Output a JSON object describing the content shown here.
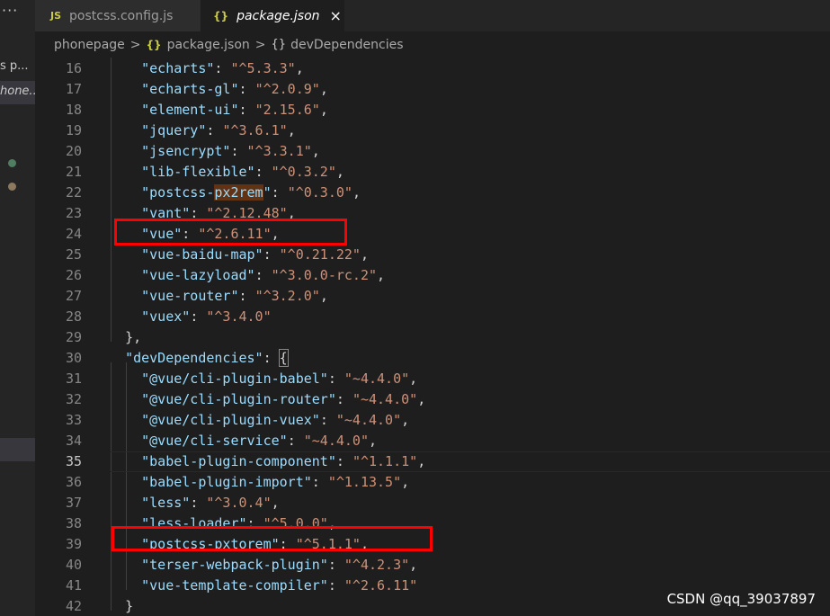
{
  "sidebar": {
    "more": "···",
    "item1": "s p...",
    "item2": "hone..."
  },
  "tabs": [
    {
      "icon": "JS",
      "label": "postcss.config.js"
    },
    {
      "icon": "{}",
      "label": "package.json",
      "close": "×"
    }
  ],
  "breadcrumb": {
    "folder": "phonepage",
    "file": "package.json",
    "node": "devDependencies",
    "sep": ">"
  },
  "editor": {
    "lines": [
      {
        "n": "16",
        "key": "\"echarts\"",
        "val": "\"^5.3.3\"",
        "end": ","
      },
      {
        "n": "17",
        "key": "\"echarts-gl\"",
        "val": "\"^2.0.9\"",
        "end": ","
      },
      {
        "n": "18",
        "key": "\"element-ui\"",
        "val": "\"2.15.6\"",
        "end": ","
      },
      {
        "n": "19",
        "key": "\"jquery\"",
        "val": "\"^3.6.1\"",
        "end": ","
      },
      {
        "n": "20",
        "key": "\"jsencrypt\"",
        "val": "\"^3.3.1\"",
        "end": ","
      },
      {
        "n": "21",
        "key": "\"lib-flexible\"",
        "val": "\"^0.3.2\"",
        "end": ","
      },
      {
        "n": "22",
        "key_a": "\"postcss-",
        "key_hl": "px2rem",
        "key_b": "\"",
        "val": "\"^0.3.0\"",
        "end": ","
      },
      {
        "n": "23",
        "key": "\"vant\"",
        "val": "\"^2.12.48\"",
        "end": ","
      },
      {
        "n": "24",
        "key": "\"vue\"",
        "val": "\"^2.6.11\"",
        "end": ","
      },
      {
        "n": "25",
        "key": "\"vue-baidu-map\"",
        "val": "\"^0.21.22\"",
        "end": ","
      },
      {
        "n": "26",
        "key": "\"vue-lazyload\"",
        "val": "\"^3.0.0-rc.2\"",
        "end": ","
      },
      {
        "n": "27",
        "key": "\"vue-router\"",
        "val": "\"^3.2.0\"",
        "end": ","
      },
      {
        "n": "28",
        "key": "\"vuex\"",
        "val": "\"^3.4.0\"",
        "end": ""
      },
      {
        "n": "29",
        "text": "},"
      },
      {
        "n": "30",
        "key": "\"devDependencies\"",
        "brace": "{"
      },
      {
        "n": "31",
        "key": "\"@vue/cli-plugin-babel\"",
        "val": "\"~4.4.0\"",
        "end": ","
      },
      {
        "n": "32",
        "key": "\"@vue/cli-plugin-router\"",
        "val": "\"~4.4.0\"",
        "end": ","
      },
      {
        "n": "33",
        "key": "\"@vue/cli-plugin-vuex\"",
        "val": "\"~4.4.0\"",
        "end": ","
      },
      {
        "n": "34",
        "key": "\"@vue/cli-service\"",
        "val": "\"~4.4.0\"",
        "end": ","
      },
      {
        "n": "35",
        "key": "\"babel-plugin-component\"",
        "val": "\"^1.1.1\"",
        "end": ","
      },
      {
        "n": "36",
        "key": "\"babel-plugin-import\"",
        "val": "\"^1.13.5\"",
        "end": ","
      },
      {
        "n": "37",
        "key": "\"less\"",
        "val": "\"^3.0.4\"",
        "end": ","
      },
      {
        "n": "38",
        "key": "\"less-loader\"",
        "val": "\"^5.0.0\"",
        "end": ","
      },
      {
        "n": "39",
        "key": "\"postcss-pxtorem\"",
        "val": "\"^5.1.1\"",
        "end": ","
      },
      {
        "n": "40",
        "key": "\"terser-webpack-plugin\"",
        "val": "\"^4.2.3\"",
        "end": ","
      },
      {
        "n": "41",
        "key": "\"vue-template-compiler\"",
        "val": "\"^2.6.11\"",
        "end": ""
      },
      {
        "n": "42",
        "text": "}"
      }
    ],
    "colon": ": ",
    "current_line": "35"
  },
  "watermark": "CSDN @qq_39037897",
  "colors": {
    "background": "#1e1e1e",
    "key": "#9cdcfe",
    "string": "#ce9178",
    "highlight_box": "#ff0000"
  }
}
